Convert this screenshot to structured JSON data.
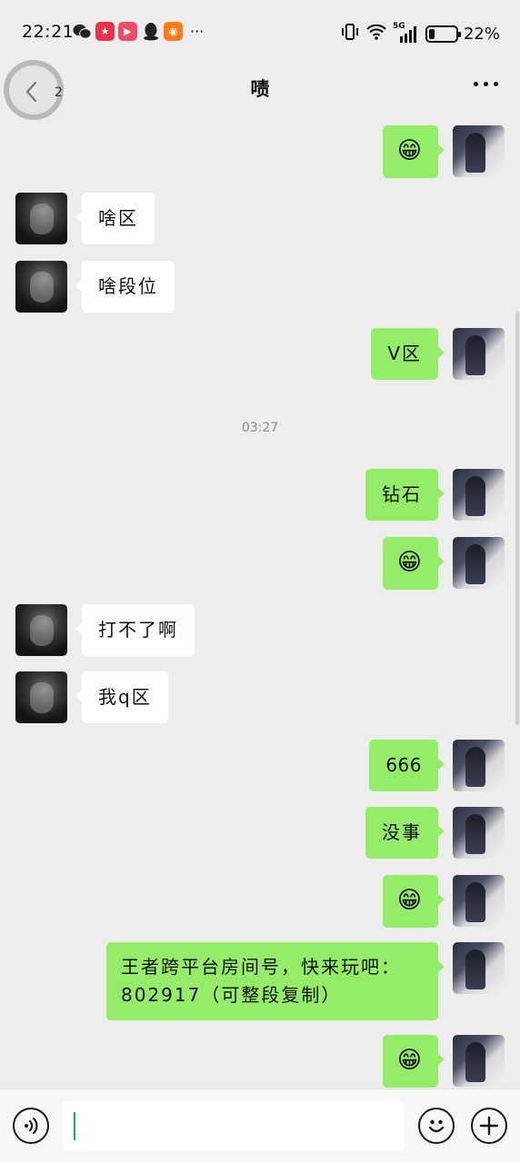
{
  "status_bar": {
    "time": "22:21",
    "more_indicator": "···",
    "network": "5G",
    "battery_percent": "22%",
    "battery_level": 0.22,
    "app_icons": [
      "wechat-icon",
      "game-app-icon",
      "video-app-icon",
      "qq-icon",
      "kuaishou-icon"
    ]
  },
  "header": {
    "back_count": "2",
    "title": "啧"
  },
  "colors": {
    "background": "#ededed",
    "sent_bubble": "#95ec69",
    "received_bubble": "#ffffff",
    "caret": "#07c160"
  },
  "messages": [
    {
      "side": "right",
      "type": "emoji",
      "text": "😁"
    },
    {
      "side": "left",
      "type": "text",
      "text": "啥区"
    },
    {
      "side": "left",
      "type": "text",
      "text": "啥段位"
    },
    {
      "side": "right",
      "type": "text",
      "text": "V区"
    },
    {
      "side": "center",
      "type": "time",
      "text": "03:27"
    },
    {
      "side": "right",
      "type": "text",
      "text": "钻石"
    },
    {
      "side": "right",
      "type": "emoji",
      "text": "😁"
    },
    {
      "side": "left",
      "type": "text",
      "text": "打不了啊"
    },
    {
      "side": "left",
      "type": "text",
      "text": "我q区"
    },
    {
      "side": "right",
      "type": "text",
      "text": "666"
    },
    {
      "side": "right",
      "type": "text",
      "text": "没事"
    },
    {
      "side": "right",
      "type": "emoji",
      "text": "😁"
    },
    {
      "side": "right",
      "type": "text",
      "text": "王者跨平台房间号，快来玩吧：802917（可整段复制）"
    },
    {
      "side": "right",
      "type": "emoji",
      "text": "😁"
    }
  ],
  "input_bar": {
    "value": "",
    "voice_icon": "voice-icon",
    "emoji_icon": "emoji-icon",
    "plus_icon": "plus-icon"
  }
}
